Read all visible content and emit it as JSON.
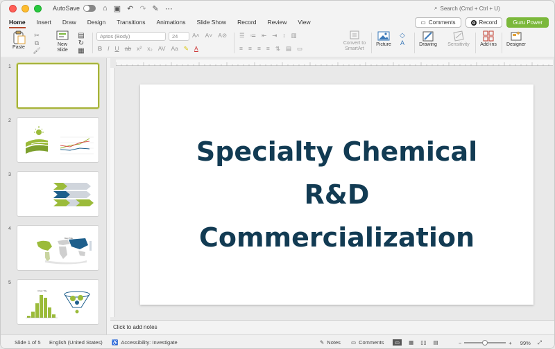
{
  "titlebar": {
    "autosave_label": "AutoSave",
    "search_placeholder": "Search (Cmd + Ctrl + U)"
  },
  "tabs": [
    {
      "label": "Home",
      "active": true
    },
    {
      "label": "Insert"
    },
    {
      "label": "Draw"
    },
    {
      "label": "Design"
    },
    {
      "label": "Transitions"
    },
    {
      "label": "Animations"
    },
    {
      "label": "Slide Show"
    },
    {
      "label": "Record"
    },
    {
      "label": "Review"
    },
    {
      "label": "View"
    }
  ],
  "top_buttons": {
    "comments": "Comments",
    "record": "Record",
    "guru": "Guru Power"
  },
  "ribbon": {
    "paste": "Paste",
    "new_slide_1": "New",
    "new_slide_2": "Slide",
    "font_name": "Aptos (Body)",
    "font_size": "24",
    "convert_1": "Convert to",
    "convert_2": "SmartArt",
    "picture": "Picture",
    "drawing": "Drawing",
    "sensitivity": "Sensitivity",
    "addins": "Add-ins",
    "designer": "Designer"
  },
  "thumbnails": [
    {
      "number": "1",
      "selected": true
    },
    {
      "number": "2"
    },
    {
      "number": "3"
    },
    {
      "number": "4"
    },
    {
      "number": "5"
    }
  ],
  "thumb_texts": {
    "map_title": "Map Title",
    "hist_title": "Chart Title"
  },
  "slide": {
    "title_lines": [
      "Specialty Chemical",
      "R&D",
      "Commercialization"
    ]
  },
  "notes_placeholder": "Click to add notes",
  "status": {
    "slide_info": "Slide 1 of 5",
    "language": "English (United States)",
    "accessibility": "Accessibility: Investigate",
    "notes": "Notes",
    "comments": "Comments",
    "zoom": "99%"
  },
  "colors": {
    "accent_green": "#7bb83b",
    "title_navy": "#123b53",
    "active_tab_underline": "#b7472a"
  }
}
